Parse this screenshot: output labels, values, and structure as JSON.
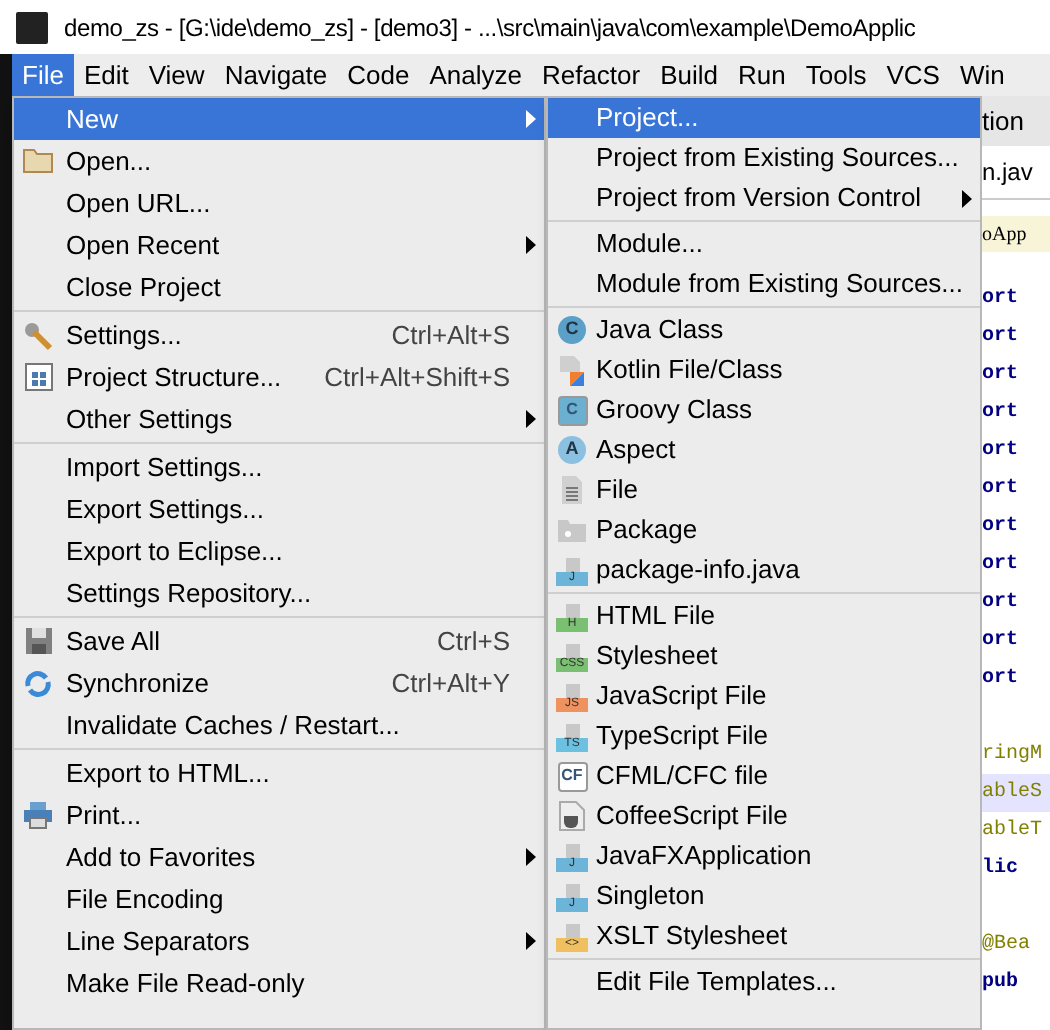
{
  "window": {
    "title": "demo_zs - [G:\\ide\\demo_zs] - [demo3] - ...\\src\\main\\java\\com\\example\\DemoApplic"
  },
  "menubar": [
    {
      "label": "File",
      "selected": true
    },
    {
      "label": "Edit",
      "selected": false
    },
    {
      "label": "View",
      "selected": false
    },
    {
      "label": "Navigate",
      "selected": false
    },
    {
      "label": "Code",
      "selected": false
    },
    {
      "label": "Analyze",
      "selected": false
    },
    {
      "label": "Refactor",
      "selected": false
    },
    {
      "label": "Build",
      "selected": false
    },
    {
      "label": "Run",
      "selected": false
    },
    {
      "label": "Tools",
      "selected": false
    },
    {
      "label": "VCS",
      "selected": false
    },
    {
      "label": "Win",
      "selected": false
    }
  ],
  "file_menu": [
    [
      {
        "label": "New",
        "kind": "plain",
        "submenu": true,
        "selected": true
      },
      {
        "label": "Open...",
        "kind": "folder",
        "submenu": false,
        "selected": false
      },
      {
        "label": "Open URL...",
        "kind": "plain",
        "submenu": false,
        "selected": false
      },
      {
        "label": "Open Recent",
        "kind": "plain",
        "submenu": true,
        "selected": false
      },
      {
        "label": "Close Project",
        "kind": "plain",
        "submenu": false,
        "selected": false
      }
    ],
    [
      {
        "label": "Settings...",
        "kind": "wrench",
        "shortcut": "Ctrl+Alt+S",
        "submenu": false,
        "selected": false
      },
      {
        "label": "Project Structure...",
        "kind": "grid",
        "shortcut": "Ctrl+Alt+Shift+S",
        "submenu": false,
        "selected": false
      },
      {
        "label": "Other Settings",
        "kind": "plain",
        "submenu": true,
        "selected": false
      }
    ],
    [
      {
        "label": "Import Settings...",
        "kind": "plain",
        "submenu": false,
        "selected": false
      },
      {
        "label": "Export Settings...",
        "kind": "plain",
        "submenu": false,
        "selected": false
      },
      {
        "label": "Export to Eclipse...",
        "kind": "plain",
        "submenu": false,
        "selected": false
      },
      {
        "label": "Settings Repository...",
        "kind": "plain",
        "submenu": false,
        "selected": false
      }
    ],
    [
      {
        "label": "Save All",
        "kind": "save",
        "shortcut": "Ctrl+S",
        "submenu": false,
        "selected": false
      },
      {
        "label": "Synchronize",
        "kind": "sync",
        "shortcut": "Ctrl+Alt+Y",
        "submenu": false,
        "selected": false
      },
      {
        "label": "Invalidate Caches / Restart...",
        "kind": "plain",
        "submenu": false,
        "selected": false
      }
    ],
    [
      {
        "label": "Export to HTML...",
        "kind": "plain",
        "submenu": false,
        "selected": false
      },
      {
        "label": "Print...",
        "kind": "print",
        "submenu": false,
        "selected": false
      },
      {
        "label": "Add to Favorites",
        "kind": "plain",
        "submenu": true,
        "selected": false
      },
      {
        "label": "File Encoding",
        "kind": "plain",
        "submenu": false,
        "selected": false
      },
      {
        "label": "Line Separators",
        "kind": "plain",
        "submenu": true,
        "selected": false
      },
      {
        "label": "Make File Read-only",
        "kind": "plain",
        "submenu": false,
        "selected": false
      }
    ]
  ],
  "new_submenu": [
    [
      {
        "label": "Project...",
        "kind": "plain",
        "submenu": false,
        "selected": true
      },
      {
        "label": "Project from Existing Sources...",
        "kind": "plain",
        "submenu": false,
        "selected": false
      },
      {
        "label": "Project from Version Control",
        "kind": "plain",
        "submenu": true,
        "selected": false
      }
    ],
    [
      {
        "label": "Module...",
        "kind": "plain",
        "submenu": false,
        "selected": false
      },
      {
        "label": "Module from Existing Sources...",
        "kind": "plain",
        "submenu": false,
        "selected": false
      }
    ],
    [
      {
        "label": "Java Class",
        "kind": "circle",
        "badge": "C",
        "color": "#5aa0c8",
        "submenu": false,
        "selected": false
      },
      {
        "label": "Kotlin File/Class",
        "kind": "kotlin",
        "submenu": false,
        "selected": false
      },
      {
        "label": "Groovy Class",
        "kind": "square",
        "badge": "C",
        "color": "#6bb0d0",
        "submenu": false,
        "selected": false
      },
      {
        "label": "Aspect",
        "kind": "circle",
        "badge": "A",
        "color": "#8cc0e0",
        "submenu": false,
        "selected": false
      },
      {
        "label": "File",
        "kind": "file",
        "submenu": false,
        "selected": false
      },
      {
        "label": "Package",
        "kind": "package",
        "submenu": false,
        "selected": false
      },
      {
        "label": "package-info.java",
        "kind": "typed",
        "badge": "J",
        "color": "#6cb4d8",
        "submenu": false,
        "selected": false
      }
    ],
    [
      {
        "label": "HTML File",
        "kind": "typed",
        "badge": "H",
        "color": "#7bbf72",
        "submenu": false,
        "selected": false
      },
      {
        "label": "Stylesheet",
        "kind": "typed",
        "badge": "CSS",
        "color": "#7bbf72",
        "submenu": false,
        "selected": false
      },
      {
        "label": "JavaScript File",
        "kind": "typed",
        "badge": "JS",
        "color": "#ee9260",
        "submenu": false,
        "selected": false
      },
      {
        "label": "TypeScript File",
        "kind": "typed",
        "badge": "TS",
        "color": "#6cc0e0",
        "submenu": false,
        "selected": false
      },
      {
        "label": "CFML/CFC file",
        "kind": "square",
        "badge": "CF",
        "color": "#ffffff",
        "submenu": false,
        "selected": false
      },
      {
        "label": "CoffeeScript File",
        "kind": "cup",
        "submenu": false,
        "selected": false
      },
      {
        "label": "JavaFXApplication",
        "kind": "typed",
        "badge": "J",
        "color": "#6cb4d8",
        "submenu": false,
        "selected": false
      },
      {
        "label": "Singleton",
        "kind": "typed",
        "badge": "J",
        "color": "#6cb4d8",
        "submenu": false,
        "selected": false
      },
      {
        "label": "XSLT Stylesheet",
        "kind": "typed",
        "badge": "<>",
        "color": "#f0c060",
        "submenu": false,
        "selected": false
      }
    ],
    [
      {
        "label": "Edit File Templates...",
        "kind": "plain",
        "submenu": false,
        "selected": false
      }
    ]
  ],
  "editor": {
    "tab": "tion",
    "file_tab": "n.jav",
    "breadcrumb": "oApp",
    "lines": [
      {
        "text": "ort",
        "kind": "keyword"
      },
      {
        "text": "ort",
        "kind": "keyword"
      },
      {
        "text": "ort",
        "kind": "keyword"
      },
      {
        "text": "ort",
        "kind": "keyword"
      },
      {
        "text": "ort",
        "kind": "keyword"
      },
      {
        "text": "ort",
        "kind": "keyword"
      },
      {
        "text": "ort",
        "kind": "keyword"
      },
      {
        "text": "ort",
        "kind": "keyword"
      },
      {
        "text": "ort",
        "kind": "keyword"
      },
      {
        "text": "ort",
        "kind": "keyword"
      },
      {
        "text": "ort",
        "kind": "keyword"
      },
      {
        "kind": "blank"
      },
      {
        "text": "ringM",
        "kind": "annotation"
      },
      {
        "text": "ableS",
        "kind": "annotation-hl"
      },
      {
        "text": "ableT",
        "kind": "annotation"
      },
      {
        "text": "lic",
        "kind": "keyword"
      },
      {
        "kind": "blank"
      },
      {
        "text": "@Bea",
        "kind": "annotation"
      },
      {
        "text": "pub",
        "kind": "keyword"
      }
    ]
  }
}
